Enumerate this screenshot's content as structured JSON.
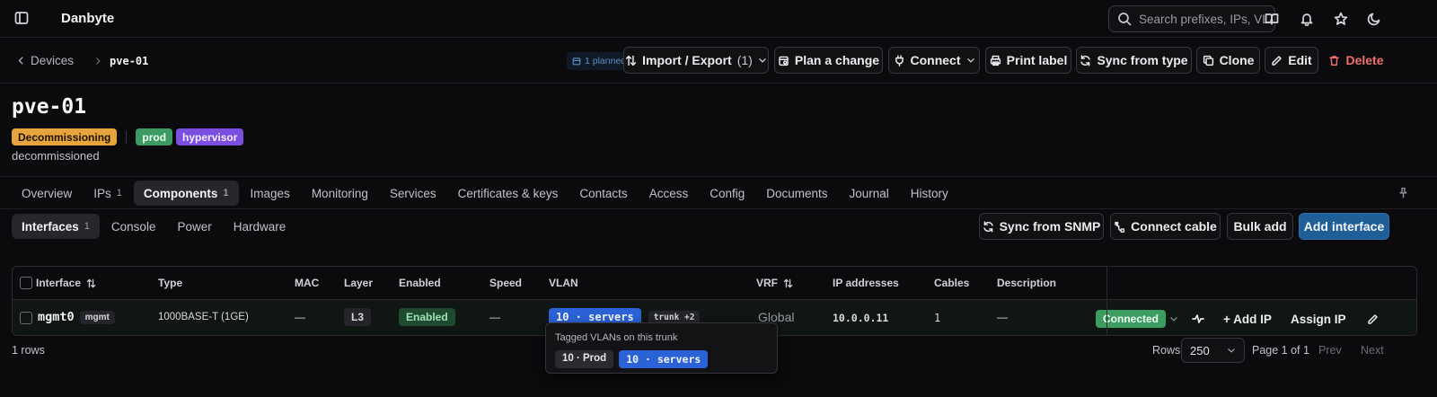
{
  "app": {
    "title": "Danbyte"
  },
  "search": {
    "placeholder": "Search prefixes, IPs, VLANs…"
  },
  "breadcrumb": {
    "back": "Devices",
    "current": "pve-01"
  },
  "toolbar": {
    "planned": "1 planned",
    "import_export": "Import / Export",
    "import_export_count": "(1)",
    "plan_change": "Plan a change",
    "connect": "Connect",
    "print_label": "Print label",
    "sync_type": "Sync from type",
    "clone": "Clone",
    "edit": "Edit",
    "delete": "Delete"
  },
  "device": {
    "name": "pve-01",
    "status": "Decommissioning",
    "tags": [
      "prod",
      "hypervisor"
    ],
    "description": "decommissioned"
  },
  "tabs": [
    {
      "label": "Overview",
      "count": ""
    },
    {
      "label": "IPs",
      "count": "1"
    },
    {
      "label": "Components",
      "count": "1"
    },
    {
      "label": "Images",
      "count": ""
    },
    {
      "label": "Monitoring",
      "count": ""
    },
    {
      "label": "Services",
      "count": ""
    },
    {
      "label": "Certificates & keys",
      "count": ""
    },
    {
      "label": "Contacts",
      "count": ""
    },
    {
      "label": "Access",
      "count": ""
    },
    {
      "label": "Config",
      "count": ""
    },
    {
      "label": "Documents",
      "count": ""
    },
    {
      "label": "Journal",
      "count": ""
    },
    {
      "label": "History",
      "count": ""
    }
  ],
  "subtabs": [
    {
      "label": "Interfaces",
      "count": "1"
    },
    {
      "label": "Console",
      "count": ""
    },
    {
      "label": "Power",
      "count": ""
    },
    {
      "label": "Hardware",
      "count": ""
    }
  ],
  "subtoolbar": {
    "sync_snmp": "Sync from SNMP",
    "connect_cable": "Connect cable",
    "bulk_add": "Bulk add",
    "add_interface": "Add interface"
  },
  "table": {
    "columns": {
      "interface": "Interface",
      "type": "Type",
      "mac": "MAC",
      "layer": "Layer",
      "enabled": "Enabled",
      "speed": "Speed",
      "vlan": "VLAN",
      "vrf": "VRF",
      "ip": "IP addresses",
      "cables": "Cables",
      "description": "Description"
    },
    "row": {
      "name": "mgmt0",
      "tag": "mgmt",
      "type": "1000BASE-T (1GE)",
      "mac": "—",
      "layer": "L3",
      "enabled": "Enabled",
      "speed": "—",
      "vlan": "10 · servers",
      "vlan_extra": "trunk +2",
      "vrf": "Global",
      "ip": "10.0.0.11",
      "cables": "1",
      "description": "—",
      "connection": "Connected",
      "add_ip": "+ Add IP",
      "assign_ip": "Assign IP"
    }
  },
  "tooltip": {
    "title": "Tagged VLANs on this trunk",
    "tags": [
      "10 · Prod",
      "10 · servers"
    ]
  },
  "footer": {
    "row_count": "1 rows",
    "rows_label": "Rows",
    "rows_value": "250",
    "page_info": "Page 1 of 1",
    "prev": "Prev",
    "next": "Next"
  },
  "colors": {
    "background": "#0b0b0d",
    "status_warning": "#e8a43c",
    "tag_prod": "#3c9b63",
    "tag_hypervisor": "#7b4ee0",
    "primary": "#1f5e96",
    "vlan_blue": "#2b63d6",
    "danger": "#f07070"
  },
  "icons": [
    "sidebar-toggle-icon",
    "search-icon",
    "book-icon",
    "bell-icon",
    "star-icon",
    "moon-icon",
    "chevron-left-icon",
    "chevron-right-icon",
    "calendar-icon",
    "sort-arrows-icon",
    "chevron-down-icon",
    "clipboard-icon",
    "plug-icon",
    "printer-icon",
    "refresh-icon",
    "copy-icon",
    "pencil-icon",
    "trash-icon",
    "pin-icon",
    "cable-icon",
    "trace-icon"
  ]
}
